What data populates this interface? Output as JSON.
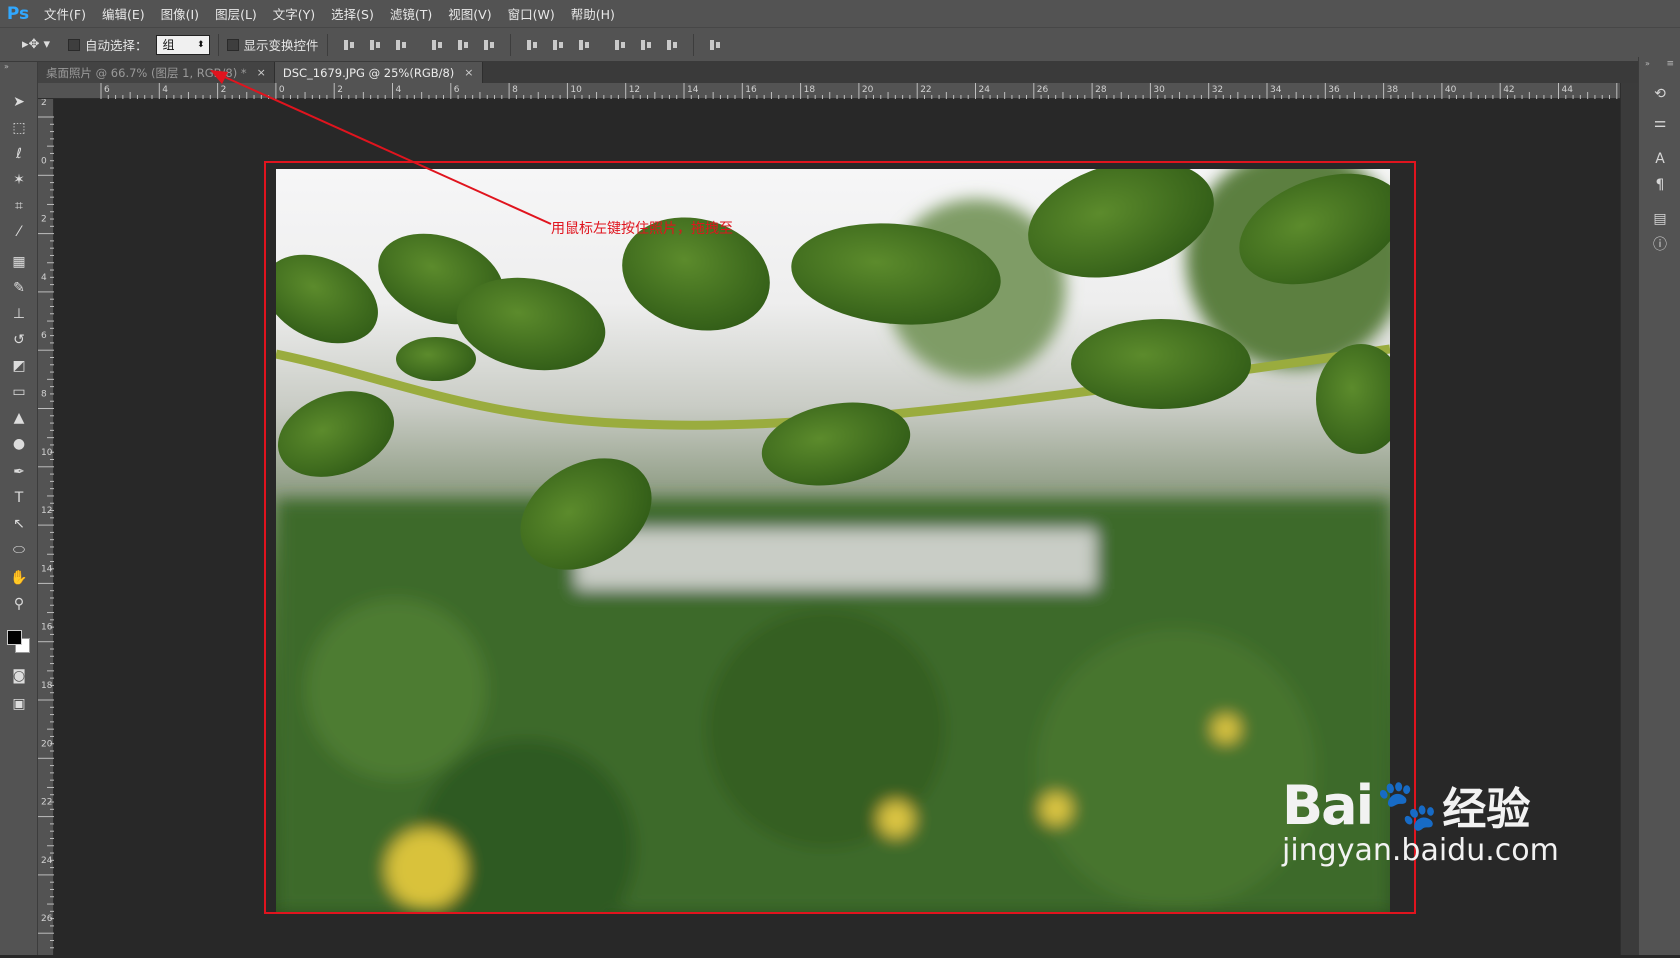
{
  "app": {
    "logo": "Ps"
  },
  "menu": [
    "文件(F)",
    "编辑(E)",
    "图像(I)",
    "图层(L)",
    "文字(Y)",
    "选择(S)",
    "滤镜(T)",
    "视图(V)",
    "窗口(W)",
    "帮助(H)"
  ],
  "options": {
    "auto_select_label": "自动选择：",
    "auto_select_value": "组",
    "show_transform_label": "显示变换控件"
  },
  "tabs": [
    {
      "label": "桌面照片 @ 66.7% (图层 1, RGB/8) *",
      "close": "×"
    },
    {
      "label": "DSC_1679.JPG @ 25%(RGB/8)",
      "close": "×"
    }
  ],
  "ruler_h_ticks": [
    "6",
    "4",
    "2",
    "0",
    "2",
    "4",
    "6",
    "8",
    "10",
    "12",
    "14",
    "16",
    "18",
    "20",
    "22",
    "24",
    "26",
    "28",
    "30",
    "32",
    "34",
    "36",
    "38",
    "40",
    "42",
    "44"
  ],
  "ruler_v_ticks": [
    "2",
    "0",
    "2",
    "4",
    "6",
    "8",
    "10",
    "12",
    "14",
    "16",
    "18",
    "20",
    "22",
    "24",
    "26"
  ],
  "annotation": "用鼠标左键按住照片，拖拽至",
  "annotation_color": "#e0141e",
  "watermark": {
    "brand": "Bai",
    "brand2": "经验",
    "url": "jingyan.baidu.com"
  },
  "tools": [
    "move-tool-icon",
    "marquee-icon",
    "lasso-icon",
    "magic-wand-icon",
    "crop-icon",
    "eyedropper-icon",
    "healing-icon",
    "brush-icon",
    "stamp-icon",
    "history-brush-icon",
    "eraser-icon",
    "gradient-icon",
    "blur-icon",
    "dodge-icon",
    "pen-icon",
    "type-icon",
    "path-select-icon",
    "ellipse-icon",
    "hand-icon",
    "zoom-icon"
  ]
}
